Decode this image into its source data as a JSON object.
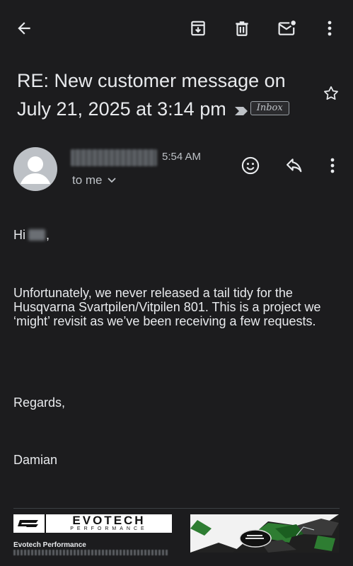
{
  "toolbar": {
    "back_icon": "arrow-back-icon",
    "archive_icon": "archive-icon",
    "delete_icon": "trash-icon",
    "unread_icon": "mark-unread-icon",
    "more_icon": "more-vert-icon"
  },
  "subject": {
    "text": "RE: New customer message on July 21, 2025 at 3:14 pm",
    "label": "Inbox"
  },
  "sender": {
    "time": "5:54 AM",
    "recipient": "to me"
  },
  "message": {
    "greeting_start": "Hi",
    "greeting_end": ",",
    "paragraph": "Unfortunately, we never released a tail tidy for the Husqvarna Svartpilen/Vitpilen 801. This is a project we ‘might’ revisit as we’ve been receiving a few requests.",
    "closing": "Regards,",
    "signature_name": "Damian"
  },
  "signature": {
    "logo_text": "EVOTECH",
    "logo_sub": "PERFORMANCE",
    "company": "Evotech Performance"
  },
  "colors": {
    "background": "#1c1c1e",
    "text": "#e8eaed",
    "secondary": "#bdc1c6",
    "accent_green": "#2e7d32"
  }
}
